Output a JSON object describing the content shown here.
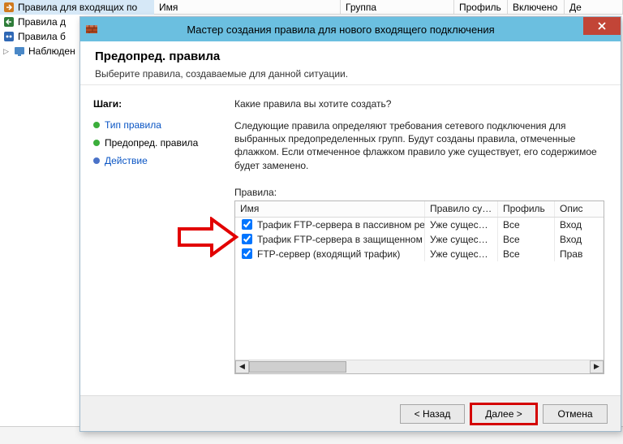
{
  "background": {
    "tree": [
      {
        "label": "Правила для входящих по",
        "selected": true,
        "icon": "inbound"
      },
      {
        "label": "Правила д",
        "icon": "outbound"
      },
      {
        "label": "Правила б",
        "icon": "conn"
      },
      {
        "label": "Наблюден",
        "icon": "monitor"
      }
    ],
    "columns": [
      "Имя",
      "Группа",
      "Профиль",
      "Включено",
      "Де"
    ]
  },
  "wizard": {
    "title": "Мастер создания правила для нового входящего подключения",
    "close_aria": "Закрыть",
    "heading": "Предопред. правила",
    "subheading": "Выберите правила, создаваемые для данной ситуации.",
    "steps_title": "Шаги:",
    "steps": [
      {
        "label": "Тип правила",
        "state": "done",
        "link": true
      },
      {
        "label": "Предопред. правила",
        "state": "current",
        "link": false
      },
      {
        "label": "Действие",
        "state": "todo",
        "link": true
      }
    ],
    "question": "Какие правила вы хотите создать?",
    "description": "Следующие правила определяют требования сетевого подключения для выбранных предопределенных групп. Будут созданы правила, отмеченные флажком. Если отмеченное флажком правило уже существует, его содержимое будет заменено.",
    "rules_label": "Правила:",
    "columns": {
      "c0": "Имя",
      "c1": "Правило сущ…",
      "c2": "Профиль",
      "c3": "Опис"
    },
    "rows": [
      {
        "checked": true,
        "name": "Трафик FTP-сервера в пассивном режим…",
        "exists": "Уже существ…",
        "profile": "Все",
        "desc": "Вход"
      },
      {
        "checked": true,
        "name": "Трафик FTP-сервера в защищенном режи…",
        "exists": "Уже существ…",
        "profile": "Все",
        "desc": "Вход"
      },
      {
        "checked": true,
        "name": "FTP-сервер (входящий трафик)",
        "exists": "Уже существ…",
        "profile": "Все",
        "desc": "Прав"
      }
    ],
    "buttons": {
      "back": "< Назад",
      "next": "Далее >",
      "cancel": "Отмена"
    }
  }
}
